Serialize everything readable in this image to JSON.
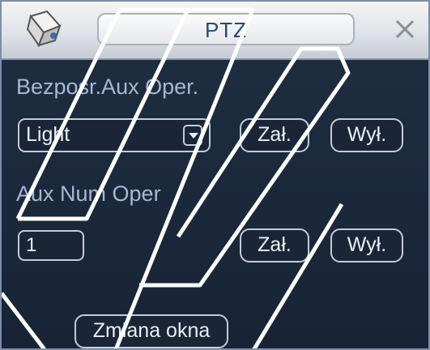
{
  "window": {
    "title": "PTZ"
  },
  "direct_aux": {
    "label": "Bezposr.Aux Oper.",
    "selected_option": "Light",
    "on_label": "Zał.",
    "off_label": "Wył."
  },
  "aux_num": {
    "label": "Aux Num Oper",
    "value": "1",
    "on_label": "Zał.",
    "off_label": "Wył."
  },
  "footer": {
    "switch_window_label": "Zmiana okna"
  },
  "icons": {
    "title_icon": "ptz-camera-icon",
    "close": "close-icon",
    "dropdown": "chevron-down-icon"
  },
  "colors": {
    "panel_background": "#1d2a3c",
    "label_text": "#a8b8d2",
    "control_border": "#c3ccd8",
    "title_text": "#27487a"
  }
}
